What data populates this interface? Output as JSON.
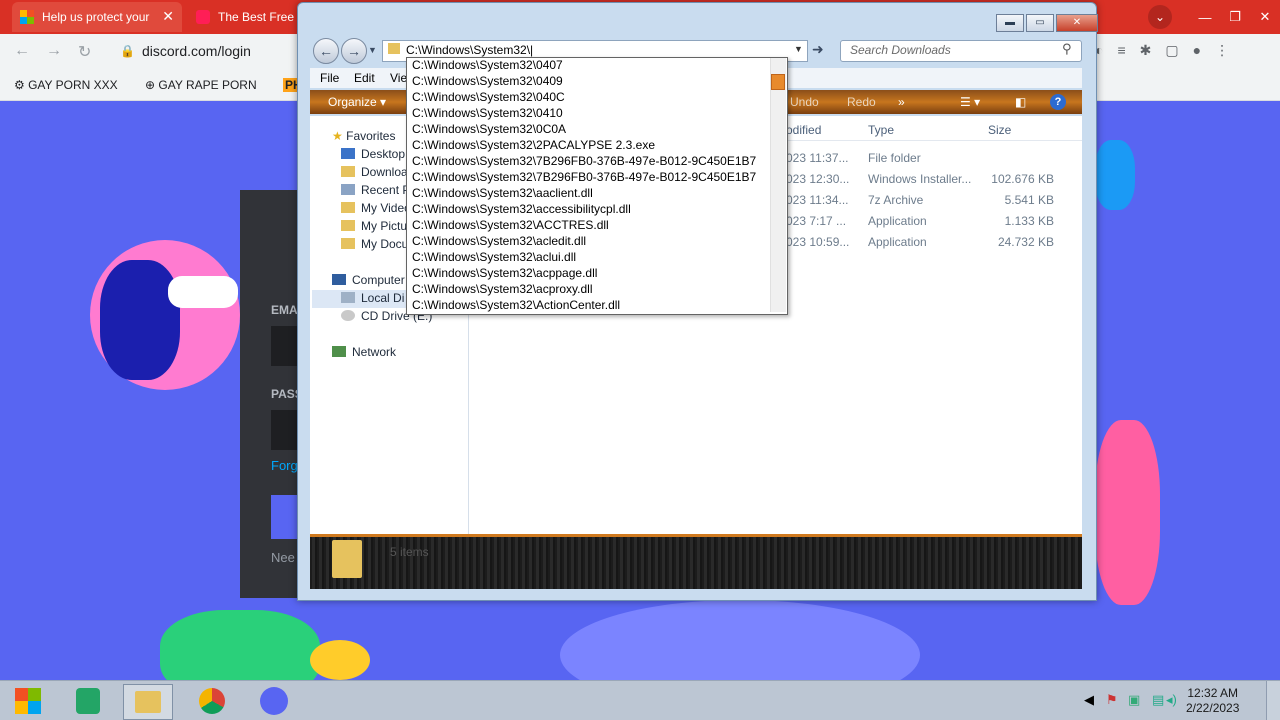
{
  "browser": {
    "tabs": [
      {
        "label": "Help us protect your"
      },
      {
        "label": "The Best Free"
      }
    ],
    "url": "discord.com/login",
    "bookmarks": [
      "GAY PORN XXX",
      "GAY RAPE PORN",
      "PH"
    ]
  },
  "discord": {
    "email_label": "EMA",
    "password_label": "PASS",
    "forgot_label": "Forg",
    "need_label": "Nee"
  },
  "explorer": {
    "address_value": "C:\\Windows\\System32\\|",
    "search_placeholder": "Search Downloads",
    "menu": [
      "File",
      "Edit",
      "Vie"
    ],
    "commands": {
      "organize": "Organize",
      "undo": "Undo",
      "redo": "Redo",
      "more": "»"
    },
    "nav_pane": {
      "favorites": "Favorites",
      "items": [
        "Desktop",
        "Downloa",
        "Recent P",
        "My Video",
        "My Pictu",
        "My Docu"
      ],
      "computer": "Computer",
      "drives": [
        "Local Di",
        "CD Drive (E:)"
      ],
      "network": "Network"
    },
    "columns": {
      "modified": "odified",
      "type": "Type",
      "size": "Size"
    },
    "files": [
      {
        "modified": "023 11:37...",
        "type": "File folder",
        "size": ""
      },
      {
        "modified": "023 12:30...",
        "type": "Windows Installer...",
        "size": "102.676 KB"
      },
      {
        "modified": "023 11:34...",
        "type": "7z Archive",
        "size": "5.541 KB"
      },
      {
        "modified": "023 7:17 ...",
        "type": "Application",
        "size": "1.133 KB"
      },
      {
        "modified": "023 10:59...",
        "type": "Application",
        "size": "24.732 KB"
      }
    ],
    "details_text": "5 items",
    "autocomplete": [
      "C:\\Windows\\System32\\0407",
      "C:\\Windows\\System32\\0409",
      "C:\\Windows\\System32\\040C",
      "C:\\Windows\\System32\\0410",
      "C:\\Windows\\System32\\0C0A",
      "C:\\Windows\\System32\\2PACALYPSE 2.3.exe",
      "C:\\Windows\\System32\\7B296FB0-376B-497e-B012-9C450E1B7",
      "C:\\Windows\\System32\\7B296FB0-376B-497e-B012-9C450E1B7",
      "C:\\Windows\\System32\\aaclient.dll",
      "C:\\Windows\\System32\\accessibilitycpl.dll",
      "C:\\Windows\\System32\\ACCTRES.dll",
      "C:\\Windows\\System32\\acledit.dll",
      "C:\\Windows\\System32\\aclui.dll",
      "C:\\Windows\\System32\\acppage.dll",
      "C:\\Windows\\System32\\acproxy.dll",
      "C:\\Windows\\System32\\ActionCenter.dll"
    ]
  },
  "taskbar": {
    "time": "12:32 AM",
    "date": "2/22/2023"
  },
  "colors": {
    "chrome_red": "#d93025",
    "discord_blurple": "#5865f2",
    "accent_orange": "#c7761e"
  }
}
